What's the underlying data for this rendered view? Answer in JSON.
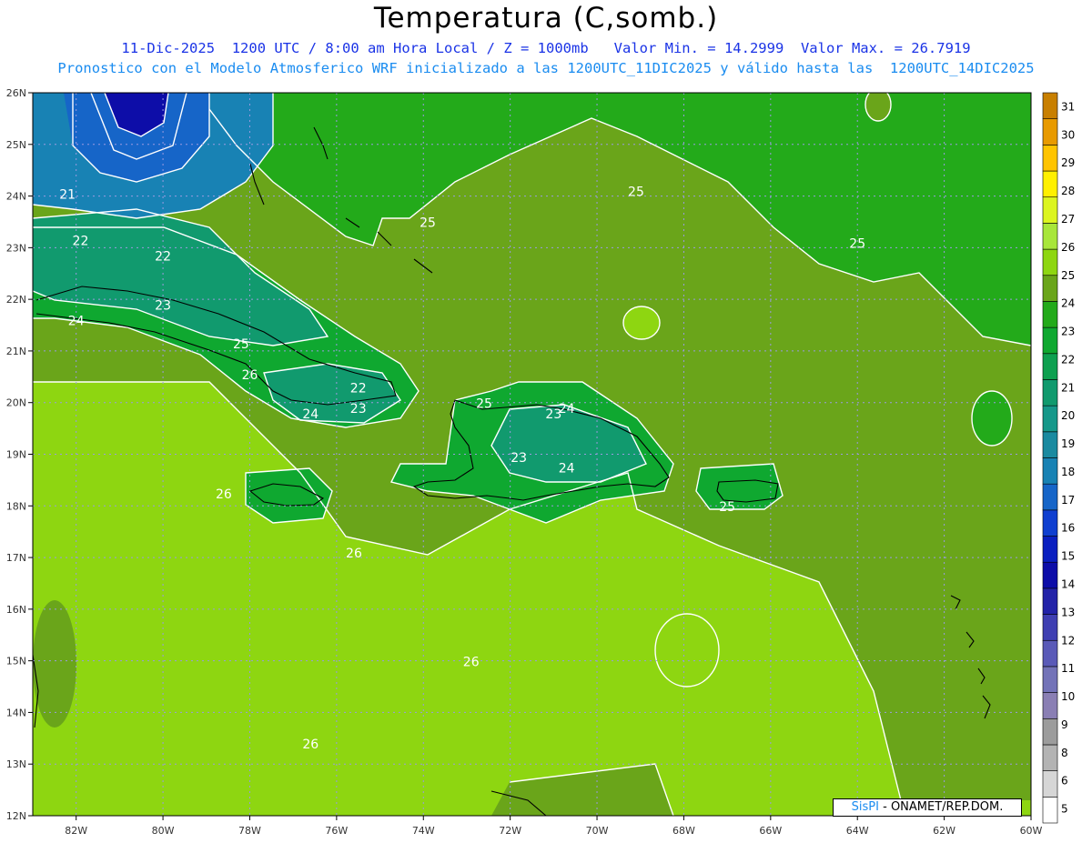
{
  "header": {
    "title": "Temperatura (C,somb.)",
    "subtitle_1": "11-Dic-2025  1200 UTC / 8:00 am Hora Local / Z = 1000mb   Valor Min. = 14.2999  Valor Max. = 26.7919",
    "subtitle_2": "Pronostico con el Modelo Atmosferico WRF inicializado a las 1200UTC_11DIC2025 y válido hasta las  1200UTC_14DIC2025"
  },
  "chart_data": {
    "type": "heatmap",
    "variable": "Temperatura (C,somb.)",
    "level": "Z = 1000mb",
    "value_min": 14.2999,
    "value_max": 26.7919,
    "lon_range": [
      -83,
      -60
    ],
    "lat_range": [
      12,
      26
    ],
    "lon_ticks": [
      "82W",
      "80W",
      "78W",
      "76W",
      "74W",
      "72W",
      "70W",
      "68W",
      "66W",
      "64W",
      "62W",
      "60W"
    ],
    "lat_ticks": [
      "12N",
      "13N",
      "14N",
      "15N",
      "16N",
      "17N",
      "18N",
      "19N",
      "20N",
      "21N",
      "22N",
      "23N",
      "24N",
      "25N",
      "26N"
    ],
    "grid": true,
    "contour_labels": [
      {
        "text": "21",
        "lon": -82.2,
        "lat": 23.95
      },
      {
        "text": "22",
        "lon": -81.9,
        "lat": 23.05
      },
      {
        "text": "22",
        "lon": -80.0,
        "lat": 22.75
      },
      {
        "text": "23",
        "lon": -80.0,
        "lat": 21.8
      },
      {
        "text": "24",
        "lon": -82.0,
        "lat": 21.5
      },
      {
        "text": "25",
        "lon": -78.2,
        "lat": 21.05
      },
      {
        "text": "26",
        "lon": -78.0,
        "lat": 20.45
      },
      {
        "text": "22",
        "lon": -75.5,
        "lat": 20.2
      },
      {
        "text": "23",
        "lon": -75.5,
        "lat": 19.8
      },
      {
        "text": "24",
        "lon": -76.6,
        "lat": 19.7
      },
      {
        "text": "25",
        "lon": -73.9,
        "lat": 23.4
      },
      {
        "text": "25",
        "lon": -72.6,
        "lat": 19.9
      },
      {
        "text": "23",
        "lon": -71.0,
        "lat": 19.7
      },
      {
        "text": "24",
        "lon": -70.7,
        "lat": 19.8
      },
      {
        "text": "23",
        "lon": -71.8,
        "lat": 18.85
      },
      {
        "text": "24",
        "lon": -70.7,
        "lat": 18.65
      },
      {
        "text": "25",
        "lon": -67.0,
        "lat": 17.9
      },
      {
        "text": "26",
        "lon": -78.6,
        "lat": 18.15
      },
      {
        "text": "26",
        "lon": -75.6,
        "lat": 17.0
      },
      {
        "text": "26",
        "lon": -72.9,
        "lat": 14.9
      },
      {
        "text": "26",
        "lon": -76.6,
        "lat": 13.3
      },
      {
        "text": "25",
        "lon": -69.1,
        "lat": 24.0
      },
      {
        "text": "25",
        "lon": -64.0,
        "lat": 23.0
      }
    ],
    "colorbar": {
      "labels": [
        "5",
        "6",
        "8",
        "9",
        "10",
        "11",
        "12",
        "13",
        "14",
        "15",
        "16",
        "17",
        "18",
        "19",
        "20",
        "21",
        "22",
        "23",
        "24",
        "25",
        "26",
        "27",
        "28",
        "29",
        "30",
        "31"
      ],
      "colors": [
        "#ffffff",
        "#d6d6d6",
        "#b3b3b3",
        "#9c9c9c",
        "#8a7fb4",
        "#7373b8",
        "#5a5ab8",
        "#3f3fb2",
        "#2323a8",
        "#0d0da8",
        "#0a1fc0",
        "#0f3fd0",
        "#1665c8",
        "#1882b4",
        "#1a8aa0",
        "#16988a",
        "#119a6e",
        "#0ea050",
        "#0fa830",
        "#23aa1a",
        "#6aa51a",
        "#8ed611",
        "#a8e63a",
        "#dcf520",
        "#fff000",
        "#ffc400",
        "#e89a00",
        "#c87f00"
      ]
    },
    "colors": {
      "very_warm": "#8ed611",
      "warm": "#6aa51a",
      "mild": "#23aa1a",
      "cool": "#0fa830",
      "cooler": "#119a6e",
      "cold": "#1882b4",
      "coldest": "#0d0da8"
    }
  },
  "credit": {
    "brand": "SisPI",
    "text": " - ONAMET/REP.DOM."
  }
}
